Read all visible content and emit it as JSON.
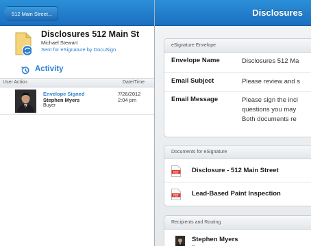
{
  "nav": {
    "back_label": "512 Main Street...",
    "title": "Disclosures"
  },
  "envelope": {
    "title": "Disclosures 512 Main St",
    "sender": "Michael Stewart",
    "status": "Sent for eSignature by DocuSign",
    "icon": "envelope-sync-icon"
  },
  "activity": {
    "heading": "Activity",
    "icon": "history-icon",
    "columns": [
      "User Action",
      "Date/Time"
    ],
    "rows": [
      {
        "action": "Envelope Signed",
        "name": "Stephen Myers",
        "role": "Buyer",
        "date": "7/26/2012",
        "time": "2:04 pm"
      }
    ]
  },
  "details": {
    "section_title": "eSignature Envelope",
    "fields": [
      {
        "key": "Envelope Name",
        "value": "Disclosures 512 Ma"
      },
      {
        "key": "Email Subject",
        "value": "Please review and s"
      },
      {
        "key": "Email Message",
        "value_lines": [
          "Please sign the incl",
          "questions you may",
          "Both documents re"
        ]
      }
    ]
  },
  "documents": {
    "section_title": "Documents for eSignature",
    "items": [
      "Disclosure - 512 Main Street",
      "Lead-Based Paint Inspection"
    ]
  },
  "recipients": {
    "section_title": "Recipients and Routing",
    "items": [
      {
        "name": "Stephen Myers",
        "role": "Buyer"
      }
    ]
  },
  "colors": {
    "nav_blue": "#1b6fc0",
    "link_blue": "#2d7fd0",
    "pdf_red": "#d8372d"
  }
}
